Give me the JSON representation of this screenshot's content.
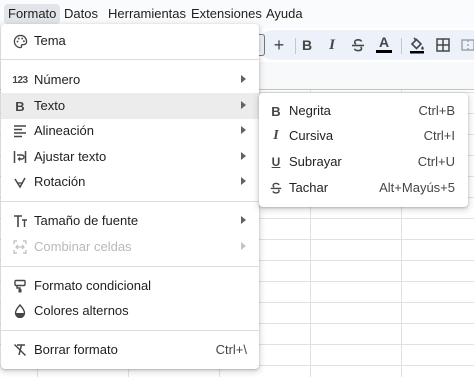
{
  "menubar": {
    "items": [
      {
        "label": "Formato",
        "active": true
      },
      {
        "label": "Datos"
      },
      {
        "label": "Herramientas"
      },
      {
        "label": "Extensiones"
      },
      {
        "label": "Ayuda"
      }
    ]
  },
  "toolbar": {
    "buttons": [
      "plus-icon",
      "bold-icon",
      "italic-icon",
      "strikethrough-icon",
      "text-color-icon",
      "fill-color-icon",
      "borders-icon",
      "merge-icon"
    ],
    "text_color_underline": "#000000",
    "plus": "+",
    "bold": "B",
    "italic": "I",
    "text_color": "A"
  },
  "format_menu": {
    "items": [
      {
        "label": "Tema",
        "icon": "palette-icon"
      },
      {
        "label": "Número",
        "icon": "number-format-icon",
        "icon_text": "123",
        "submenu": true
      },
      {
        "label": "Texto",
        "icon": "bold-icon",
        "icon_text": "B",
        "submenu": true,
        "highlighted": true
      },
      {
        "label": "Alineación",
        "icon": "align-icon",
        "submenu": true
      },
      {
        "label": "Ajustar texto",
        "icon": "wrap-text-icon",
        "submenu": true
      },
      {
        "label": "Rotación",
        "icon": "rotation-icon",
        "submenu": true
      },
      {
        "label": "Tamaño de fuente",
        "icon": "font-size-icon",
        "submenu": true
      },
      {
        "label": "Combinar celdas",
        "icon": "merge-cells-icon",
        "submenu": true,
        "disabled": true
      },
      {
        "label": "Formato condicional",
        "icon": "conditional-format-icon"
      },
      {
        "label": "Colores alternos",
        "icon": "alternating-colors-icon"
      },
      {
        "label": "Borrar formato",
        "icon": "clear-format-icon",
        "shortcut": "Ctrl+\\"
      }
    ]
  },
  "text_submenu": {
    "items": [
      {
        "label": "Negrita",
        "icon": "bold-icon",
        "icon_text": "B",
        "shortcut": "Ctrl+B"
      },
      {
        "label": "Cursiva",
        "icon": "italic-icon",
        "icon_text": "I",
        "shortcut": "Ctrl+I"
      },
      {
        "label": "Subrayar",
        "icon": "underline-icon",
        "icon_text": "U",
        "shortcut": "Ctrl+U"
      },
      {
        "label": "Tachar",
        "icon": "strikethrough-icon",
        "shortcut": "Alt+Mayús+5"
      }
    ]
  },
  "colors": {
    "menubar_bg": "#f9fbfd",
    "toolbar_bg": "#edf2fa",
    "active_menu_bg": "#e1e5ea",
    "hover_bg": "#ececec",
    "disabled_text": "#b9b9b9"
  }
}
